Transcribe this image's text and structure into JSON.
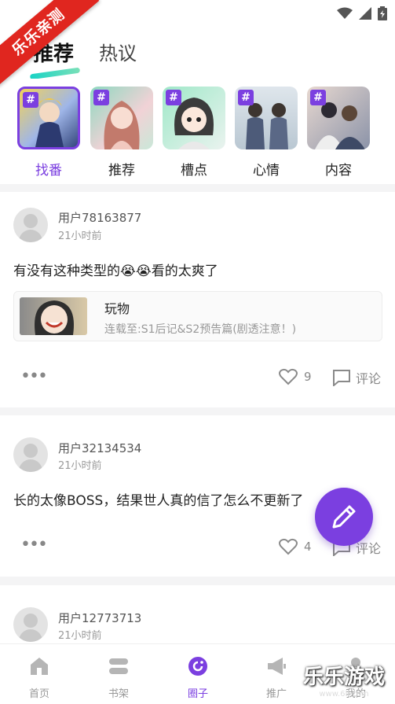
{
  "watermark": {
    "ribbon": "乐乐亲测",
    "corner": "乐乐游戏",
    "corner_url": "www.6ll.com"
  },
  "header": {
    "tab_active": "推荐",
    "tab_inactive": "热议"
  },
  "topics": [
    {
      "label": "找番",
      "hash": "#",
      "selected": true
    },
    {
      "label": "推荐",
      "hash": "#",
      "selected": false
    },
    {
      "label": "槽点",
      "hash": "#",
      "selected": false
    },
    {
      "label": "心情",
      "hash": "#",
      "selected": false
    },
    {
      "label": "内容",
      "hash": "#",
      "selected": false
    }
  ],
  "posts": [
    {
      "user": "用户78163877",
      "time": "21小时前",
      "text": "有没有这种类型的😭😭看的太爽了",
      "link": {
        "title": "玩物",
        "subtitle": "连载至:S1后记&S2预告篇(剧透注意！)"
      },
      "likes": "9",
      "comment_label": "评论"
    },
    {
      "user": "用户32134534",
      "time": "21小时前",
      "text": "长的太像BOSS，结果世人真的信了怎么不更新了",
      "likes": "4",
      "comment_label": "评论"
    },
    {
      "user": "用户12773713",
      "time": "21小时前"
    }
  ],
  "more_label": "•••",
  "nav": [
    {
      "label": "首页",
      "icon": "home-icon"
    },
    {
      "label": "书架",
      "icon": "bookshelf-icon"
    },
    {
      "label": "圈子",
      "icon": "circle-icon",
      "active": true
    },
    {
      "label": "推广",
      "icon": "megaphone-icon"
    },
    {
      "label": "我的",
      "icon": "profile-icon"
    }
  ],
  "colors": {
    "accent": "#7b3fe0",
    "underline": "#19d3c5"
  }
}
